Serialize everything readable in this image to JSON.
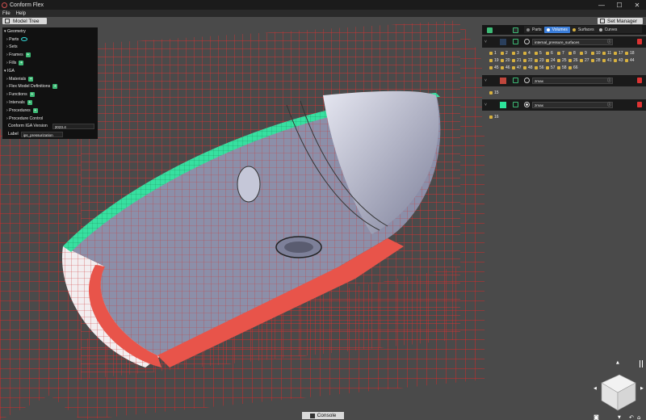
{
  "app": {
    "title": "Conform Flex",
    "menu": [
      "File",
      "Help"
    ],
    "controls": [
      "—",
      "☐",
      "✕"
    ]
  },
  "buttons": {
    "model_tree": "Model Tree",
    "set_manager": "Set Manager",
    "console": "Console"
  },
  "tree": {
    "geometry": "Geometry",
    "parts": "Parts",
    "sets": "Sets",
    "frames": "Frames",
    "fills": "Fills",
    "iga": "IGA",
    "materials": "Materials",
    "flex_model_definitions": "Flex Model Definitions",
    "functions": "Functions",
    "intervals": "Intervals",
    "procedures": "Procedures",
    "procedure_control": "Procedure Control",
    "version_label": "Conform IGA Version",
    "version_value": "2023.4",
    "label_label": "Label",
    "label_value": "ips_pressurization"
  },
  "set_manager": {
    "tabs": [
      {
        "label": "Parts",
        "color": "#888888"
      },
      {
        "label": "Volumes",
        "color": "#4fa3ff"
      },
      {
        "label": "Surfaces",
        "color": "#d9b23e"
      },
      {
        "label": "Curves",
        "color": "#bbbbbb"
      }
    ],
    "sets": [
      {
        "name": "internal_pressure_surfaces",
        "color": "#2a3f5c",
        "members": [
          "1",
          "2",
          "3",
          "4",
          "5",
          "6",
          "7",
          "8",
          "9",
          "10",
          "11",
          "17",
          "18",
          "19",
          "20",
          "21",
          "22",
          "23",
          "24",
          "25",
          "26",
          "27",
          "28",
          "41",
          "43",
          "44",
          "45",
          "46",
          "47",
          "48",
          "56",
          "57",
          "58",
          "66"
        ]
      },
      {
        "name": "zmax",
        "color": "#c0463c",
        "members": [
          "15"
        ]
      },
      {
        "name": "zmax",
        "color": "#2de39a",
        "members": [
          "16"
        ]
      }
    ]
  },
  "colors": {
    "accent": "#3dbb76",
    "grid": "#e83030",
    "solid": "#8b8ea6",
    "selected": "#2de39a",
    "delete": "#dd3333"
  },
  "icons": {
    "add": "plus-icon",
    "visibility": "eye-icon",
    "info": "info-icon",
    "trash": "trash-icon",
    "nav": "view-cube-icon"
  }
}
